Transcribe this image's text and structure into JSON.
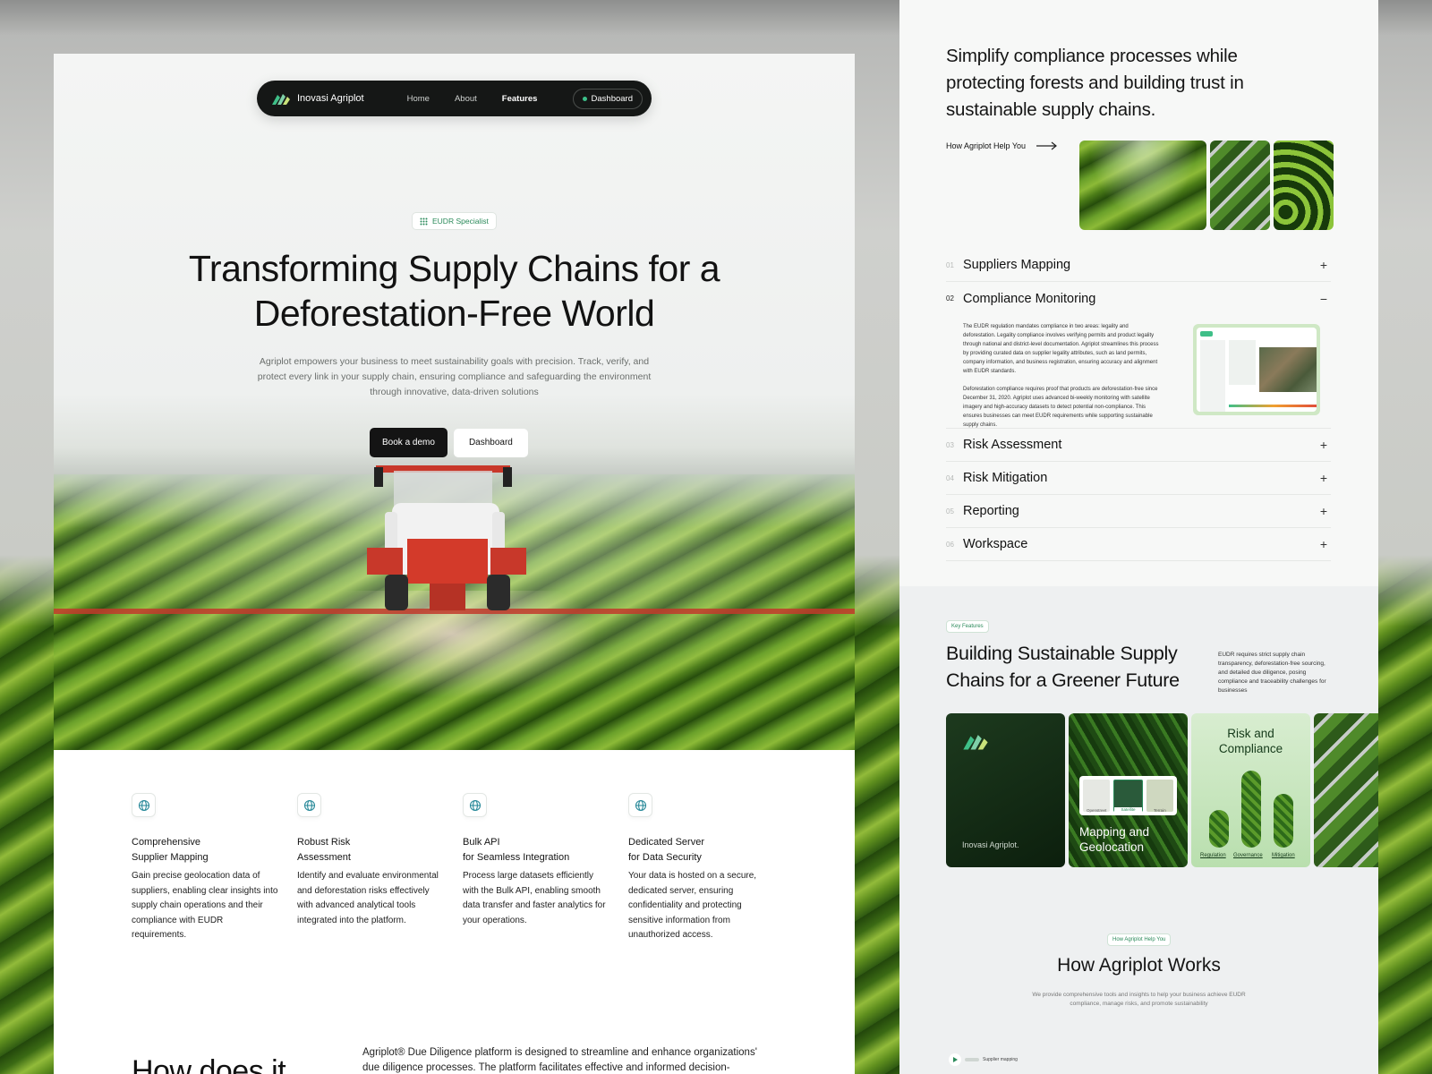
{
  "nav": {
    "brand": "Inovasi Agriplot",
    "links": [
      "Home",
      "About",
      "Features"
    ],
    "active": "Features",
    "dashboard": "Dashboard"
  },
  "hero": {
    "badge": "EUDR Specialist",
    "title_line1": "Transforming Supply Chains for a",
    "title_line2": "Deforestation-Free World",
    "subtitle": "Agriplot empowers your business to meet sustainability goals with precision. Track, verify, and protect every link in your supply chain, ensuring compliance and safeguarding the environment through innovative, data-driven solutions",
    "cta_primary": "Book a demo",
    "cta_secondary": "Dashboard"
  },
  "features": [
    {
      "icon": "globe-icon",
      "title_line1": "Comprehensive",
      "title_line2": "Supplier Mapping",
      "text": "Gain precise geolocation data of suppliers, enabling clear insights into supply chain operations and their compliance with EUDR requirements."
    },
    {
      "icon": "globe-icon",
      "title_line1": "Robust Risk",
      "title_line2": "Assessment",
      "text": "Identify and evaluate environmental and deforestation risks effectively with advanced analytical tools integrated into the platform."
    },
    {
      "icon": "globe-icon",
      "title_line1": "Bulk API",
      "title_line2": "for Seamless Integration",
      "text": "Process large datasets efficiently with the Bulk API, enabling smooth data transfer and faster analytics for your operations."
    },
    {
      "icon": "globe-icon",
      "title_line1": "Dedicated Server",
      "title_line2": "for Data Security",
      "text": "Your data is hosted on a secure, dedicated server, ensuring confidentiality and protecting sensitive information from unauthorized access."
    }
  ],
  "how": {
    "title": "How does it",
    "text": "Agriplot® Due Diligence platform is designed to streamline and enhance organizations' due diligence processes. The platform facilitates effective and informed decision-"
  },
  "right": {
    "intro": "Simplify compliance processes while protecting forests and building trust in sustainable supply chains.",
    "help_link": "How Agriplot Help You",
    "accordion": [
      {
        "num": "01",
        "label": "Suppliers Mapping",
        "open": false
      },
      {
        "num": "02",
        "label": "Compliance Monitoring",
        "open": true
      },
      {
        "num": "03",
        "label": "Risk Assessment",
        "open": false
      },
      {
        "num": "04",
        "label": "Risk Mitigation",
        "open": false
      },
      {
        "num": "05",
        "label": "Reporting",
        "open": false
      },
      {
        "num": "06",
        "label": "Workspace",
        "open": false
      }
    ],
    "compliance_p1": "The EUDR regulation mandates compliance in two areas: legality and deforestation. Legality compliance involves verifying permits and product legality through national and district-level documentation. Agriplot streamlines this process by providing curated data on supplier legality attributes, such as land permits, company information, and business registration, ensuring accuracy and alignment with EUDR standards.",
    "compliance_p2": "Deforestation compliance requires proof that products are deforestation-free since December 31, 2020. Agriplot uses advanced bi-weekly monitoring with satellite imagery and high-accuracy datasets to detect potential non-compliance. This ensures businesses can meet EUDR requirements while supporting sustainable supply chains.",
    "key_tag": "Key Features",
    "key_title": "Building Sustainable Supply Chains for a Greener Future",
    "key_side": "EUDR requires strict supply chain transparency, deforestation-free sourcing, and detailed due diligence, posing compliance and traceability challenges for businesses",
    "card_brand": "Inovasi Agriplot.",
    "card_map_title": "Mapping and Geolocation",
    "map_layers": [
      "Openstreet",
      "Satellite",
      "Terrain"
    ],
    "card_risk_title": "Risk and Compliance",
    "risk_labels": [
      "Regulation",
      "Governance",
      "Mitigation"
    ],
    "works_tag": "How Agriplot Help You",
    "works_title": "How Agriplot Works",
    "works_sub": "We provide comprehensive tools and insights to help your business achieve EUDR compliance, manage risks, and promote sustainability",
    "works_ctrl": "Supplier mapping"
  },
  "colors": {
    "accent": "#2a8a5a",
    "nav_bg": "#151716",
    "cta_dark": "#141414",
    "boom": "#c23a2b"
  }
}
